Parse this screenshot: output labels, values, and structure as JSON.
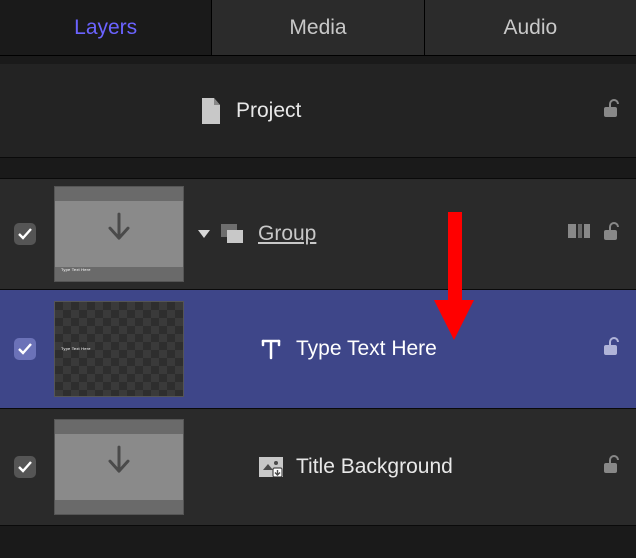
{
  "tabs": {
    "layers": "Layers",
    "media": "Media",
    "audio": "Audio",
    "active": "layers"
  },
  "rows": {
    "project": {
      "label": "Project"
    },
    "group": {
      "label": "Group"
    },
    "text": {
      "label": "Type Text Here"
    },
    "titlebg": {
      "label": "Title Background"
    }
  }
}
